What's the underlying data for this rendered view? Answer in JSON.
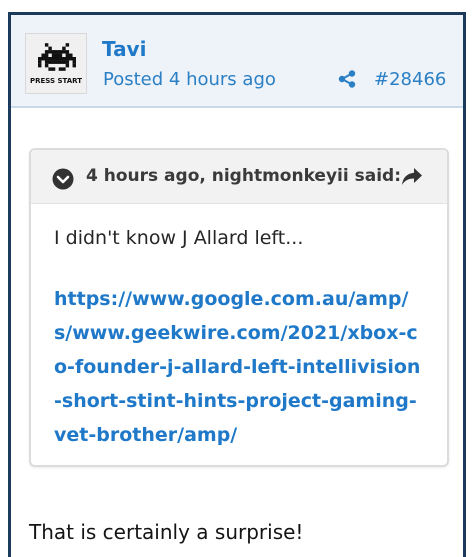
{
  "post": {
    "username": "Tavi",
    "avatar_caption": "PRESS START",
    "posted_prefix": "Posted",
    "posted_time": "4 hours ago",
    "post_number": "#28466",
    "share_icon": "share-icon"
  },
  "quote": {
    "attribution": "4 hours ago, nightmonkeyii said:",
    "text": "I didn't know J Allard left...",
    "link": "https://www.google.com.au/amp/s/www.geekwire.com/2021/xbox-co-founder-j-allard-left-intellivision-short-stint-hints-project-gaming-vet-brother/amp/"
  },
  "reply": {
    "text": "That is certainly a surprise!"
  },
  "colors": {
    "link": "#1f79c8",
    "header_bg": "#edf3f9",
    "frame_border": "#1b3a5c"
  }
}
